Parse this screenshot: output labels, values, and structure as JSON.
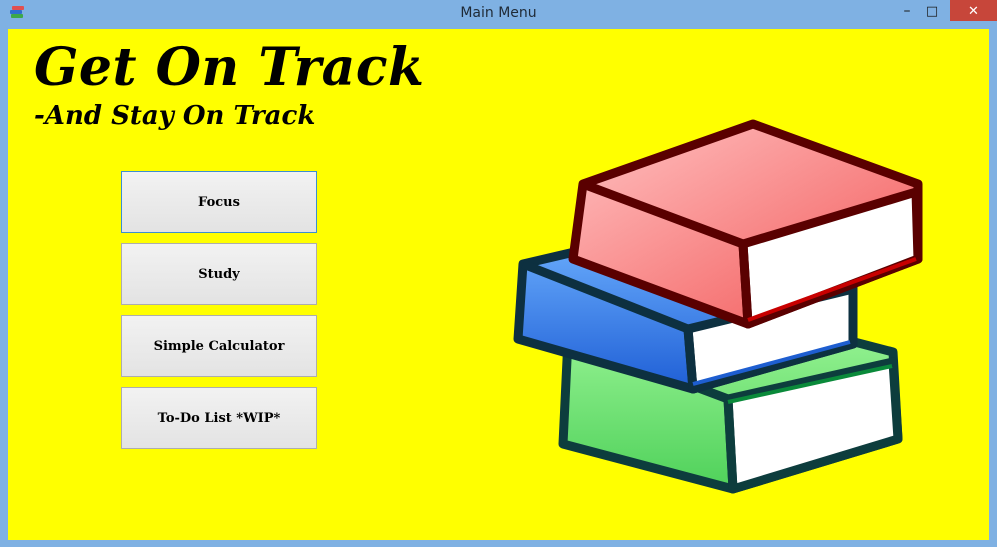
{
  "window": {
    "title": "Main Menu",
    "controls": {
      "minimize": "–",
      "maximize": "□",
      "close": "✕"
    }
  },
  "header": {
    "title": "Get On Track",
    "subtitle": "-And Stay On Track"
  },
  "menu": {
    "buttons": [
      {
        "label": "Focus"
      },
      {
        "label": "Study"
      },
      {
        "label": "Simple Calculator"
      },
      {
        "label": "To-Do List *WIP*"
      }
    ]
  },
  "illustration": {
    "icon": "stack-of-books-icon"
  },
  "colors": {
    "background": "#ffff00",
    "titlebar": "#7fb1e3",
    "close": "#c7463a"
  }
}
